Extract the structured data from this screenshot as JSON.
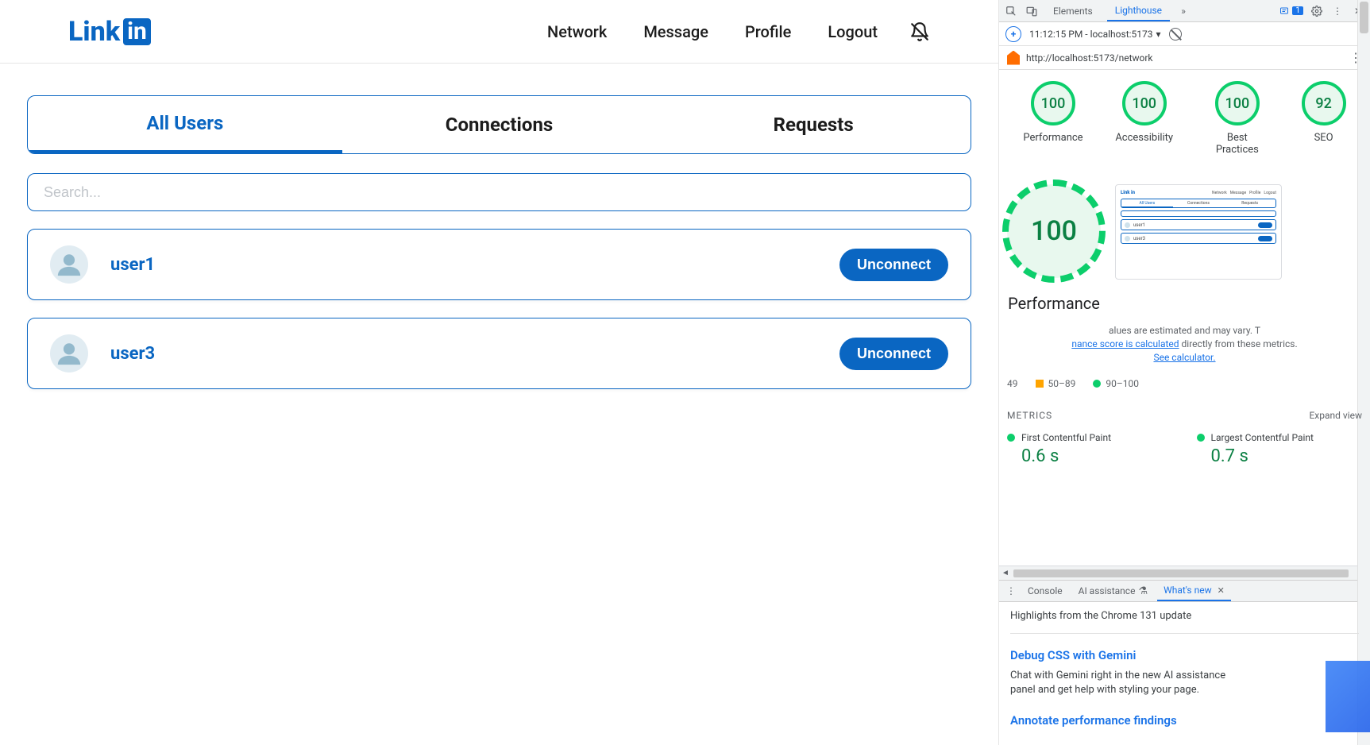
{
  "app": {
    "logo_text": "Link",
    "logo_box": "in",
    "nav": {
      "network": "Network",
      "message": "Message",
      "profile": "Profile",
      "logout": "Logout"
    },
    "tabs": {
      "all_users": "All Users",
      "connections": "Connections",
      "requests": "Requests"
    },
    "search_placeholder": "Search...",
    "users": [
      {
        "name": "user1",
        "action": "Unconnect"
      },
      {
        "name": "user3",
        "action": "Unconnect"
      }
    ]
  },
  "devtools": {
    "tabs": {
      "elements": "Elements",
      "lighthouse": "Lighthouse"
    },
    "msg_count": "1",
    "toolbar_time": "11:12:15 PM - localhost:5173",
    "url": "http://localhost:5173/network",
    "gauges": [
      {
        "score": "100",
        "label": "Performance"
      },
      {
        "score": "100",
        "label": "Accessibility"
      },
      {
        "score": "100",
        "label": "Best Practices"
      },
      {
        "score": "92",
        "label": "SEO"
      }
    ],
    "big_gauge": {
      "score": "100",
      "label": "Performance"
    },
    "thumb": {
      "logo": "Link in",
      "nav": [
        "Network",
        "Message",
        "Profile",
        "Logout"
      ],
      "tabs": [
        "All Users",
        "Connections",
        "Requests"
      ],
      "rows": [
        "user1",
        "user3"
      ]
    },
    "estimate": {
      "line1": "alues are estimated and may vary. T",
      "link1": "nance score is calculated",
      "mid": " directly from these metrics. ",
      "link2": "See calculator."
    },
    "legend": {
      "left": "49",
      "mid": "50–89",
      "right": "90–100"
    },
    "metrics_header": {
      "title": "METRICS",
      "expand": "Expand view"
    },
    "metrics": [
      {
        "name": "First Contentful Paint",
        "value": "0.6 s"
      },
      {
        "name": "Largest Contentful Paint",
        "value": "0.7 s"
      }
    ],
    "drawer": {
      "tabs": {
        "console": "Console",
        "ai": "AI assistance",
        "whatsnew": "What's new"
      },
      "highlights": "Highlights from the Chrome 131 update",
      "h1": "Debug CSS with Gemini",
      "p1": "Chat with Gemini right in the new AI assistance panel and get help with styling your page.",
      "h2": "Annotate performance findings"
    }
  }
}
